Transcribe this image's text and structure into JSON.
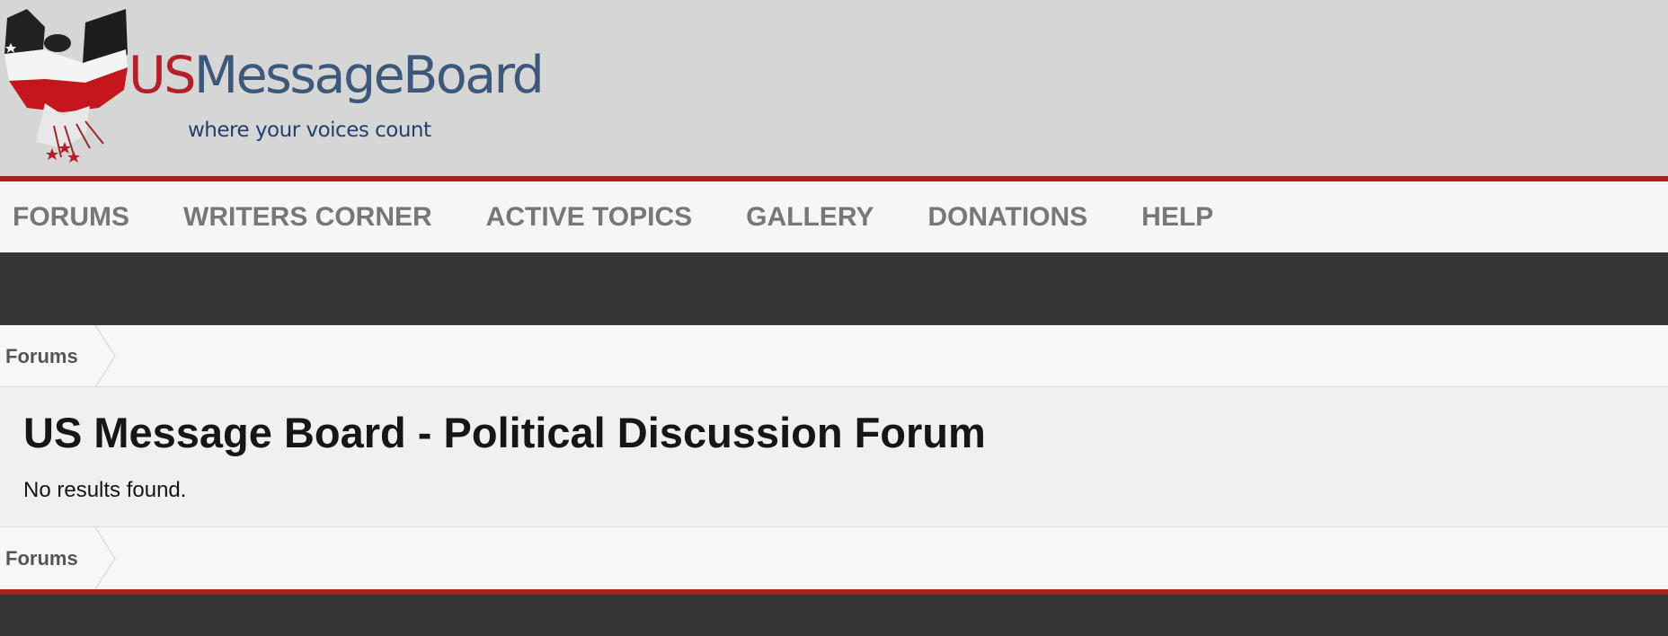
{
  "logo": {
    "brand_us": "US",
    "brand_rest": "MessageBoard",
    "tagline": "where your voices count",
    "icon": "eagle-flag-icon"
  },
  "nav": {
    "items": [
      {
        "label": "FORUMS"
      },
      {
        "label": "WRITERS CORNER"
      },
      {
        "label": "ACTIVE TOPICS"
      },
      {
        "label": "GALLERY"
      },
      {
        "label": "DONATIONS"
      },
      {
        "label": "HELP"
      }
    ]
  },
  "breadcrumb_top": {
    "label": "Forums"
  },
  "breadcrumb_bottom": {
    "label": "Forums"
  },
  "main": {
    "title": "US Message Board - Political Discussion Forum",
    "message": "No results found."
  },
  "colors": {
    "accent_red": "#a8221f",
    "dark_band": "#353535",
    "header_bg": "#d6d6d6",
    "nav_text": "#777777"
  }
}
